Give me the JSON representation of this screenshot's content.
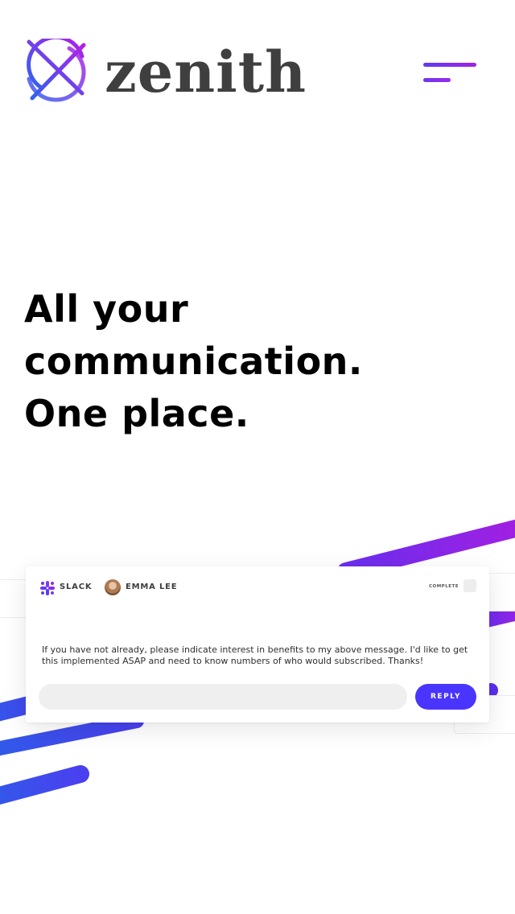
{
  "header": {
    "brand": "zenith",
    "logo_icon": "compass-target-icon",
    "menu_icon": "hamburger-menu-icon"
  },
  "hero": {
    "line1": "All your",
    "line2": "communication.",
    "line3": "One place."
  },
  "message_card": {
    "source": "SLACK",
    "source_icon": "slack-icon",
    "user": "EMMA LEE",
    "status": "COMPLETE",
    "message": "If you have not already, please indicate interest in benefits to my above message. I'd like to get this implemented ASAP and need to know numbers of who would subscribed. Thanks!",
    "reply_label": "REPLY"
  },
  "colors": {
    "accent_blue": "#4a34ff",
    "accent_purple": "#a321e3",
    "stripe_blue": "#2f5be8"
  }
}
